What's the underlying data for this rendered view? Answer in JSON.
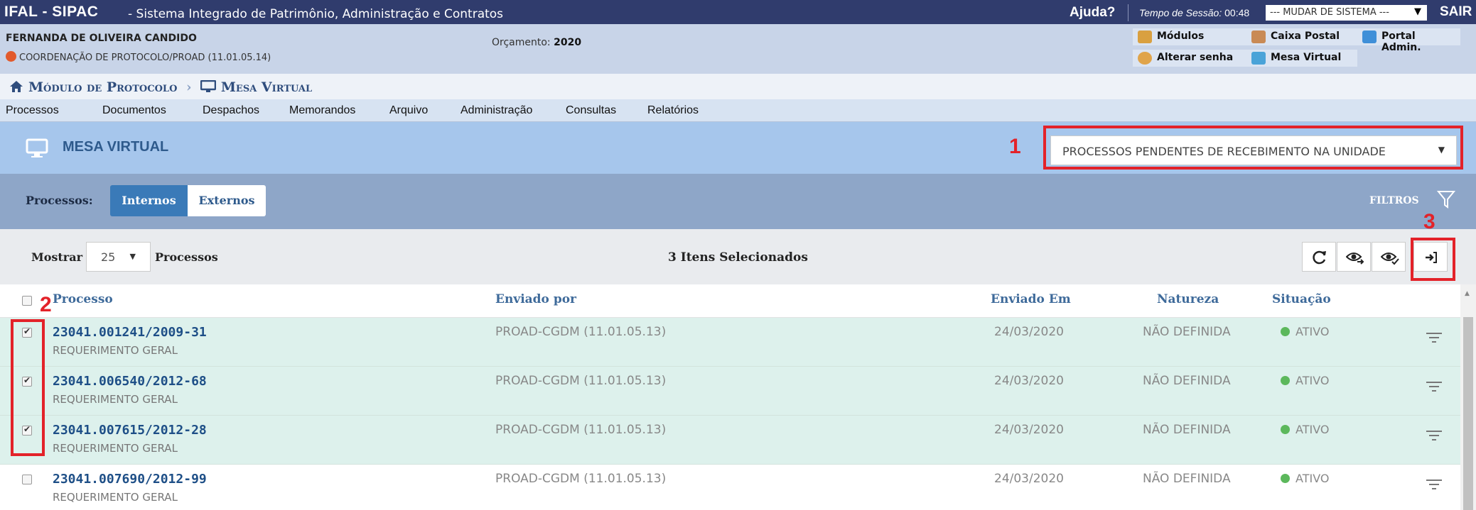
{
  "topbar": {
    "system": "IFAL - SIPAC",
    "system_name": "- Sistema Integrado de Patrimônio, Administração e Contratos",
    "help": "Ajuda?",
    "session_label": "Tempo de Sessão:",
    "session_time": "00:48",
    "switch_system": "--- MUDAR DE SISTEMA ---",
    "logout": "SAIR"
  },
  "user": {
    "name": "FERNANDA DE OLIVEIRA CANDIDO",
    "unit": "COORDENAÇÃO DE PROTOCOLO/PROAD (11.01.05.14)",
    "budget_label": "Orçamento:",
    "budget_year": "2020"
  },
  "quick_links": {
    "modulos": "Módulos",
    "caixa_postal": "Caixa Postal",
    "portal_admin": "Portal Admin.",
    "alterar_senha": "Alterar senha",
    "mesa_virtual": "Mesa Virtual"
  },
  "breadcrumb": {
    "module": "Módulo de Protocolo",
    "separator": "›",
    "page": "Mesa Virtual"
  },
  "menu": [
    "Processos",
    "Documentos",
    "Despachos",
    "Memorandos",
    "Arquivo",
    "Administração",
    "Consultas",
    "Relatórios"
  ],
  "header": {
    "title": "MESA VIRTUAL",
    "view_select": "PROCESSOS PENDENTES DE RECEBIMENTO NA UNIDADE"
  },
  "tabs": {
    "label": "Processos:",
    "internal": "Internos",
    "external": "Externos",
    "filters": "FILTROS"
  },
  "toolbar": {
    "show_label": "Mostrar",
    "page_size": "25",
    "items_label": "Processos",
    "selected": "3 Itens Selecionados"
  },
  "table": {
    "columns": [
      "Processo",
      "Enviado por",
      "Enviado Em",
      "Natureza",
      "Situação"
    ],
    "rows": [
      {
        "id": "23041.001241/2009-31",
        "type": "REQUERIMENTO GERAL",
        "sender": "PROAD-CGDM (11.01.05.13)",
        "date": "24/03/2020",
        "nature": "NÃO DEFINIDA",
        "status": "ATIVO",
        "checked": true
      },
      {
        "id": "23041.006540/2012-68",
        "type": "REQUERIMENTO GERAL",
        "sender": "PROAD-CGDM (11.01.05.13)",
        "date": "24/03/2020",
        "nature": "NÃO DEFINIDA",
        "status": "ATIVO",
        "checked": true
      },
      {
        "id": "23041.007615/2012-28",
        "type": "REQUERIMENTO GERAL",
        "sender": "PROAD-CGDM (11.01.05.13)",
        "date": "24/03/2020",
        "nature": "NÃO DEFINIDA",
        "status": "ATIVO",
        "checked": true
      },
      {
        "id": "23041.007690/2012-99",
        "type": "REQUERIMENTO GERAL",
        "sender": "PROAD-CGDM (11.01.05.13)",
        "date": "24/03/2020",
        "nature": "NÃO DEFINIDA",
        "status": "ATIVO",
        "checked": false
      }
    ]
  },
  "annotations": [
    "1",
    "2",
    "3"
  ],
  "colors": {
    "topbar": "#303c6d",
    "header": "#a6c6ec",
    "tab_active": "#3a7ab8",
    "annotation_red": "#e32229",
    "row_selected": "#ddf1ec",
    "status_green": "#5cb85c"
  },
  "icons": [
    "home-icon",
    "monitor-icon",
    "filter-icon",
    "refresh-icon",
    "eye-forward-icon",
    "eye-check-icon",
    "receive-icon",
    "row-menu-icon"
  ]
}
